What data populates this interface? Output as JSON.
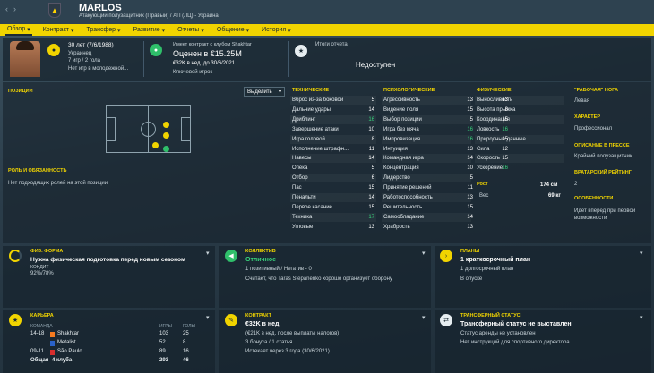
{
  "header": {
    "name": "MARLOS",
    "subtitle": "Атакующий полузащитник (Правый) / АП (ЛЦ) - Украина"
  },
  "tabs": [
    {
      "label": "Обзор",
      "arrow": "v"
    },
    {
      "label": "Контракт",
      "arrow": "v"
    },
    {
      "label": "Трансфер",
      "arrow": "v"
    },
    {
      "label": "Развитие",
      "arrow": "v"
    },
    {
      "label": "Отчеты",
      "arrow": "v"
    },
    {
      "label": "Общение",
      "arrow": "v"
    },
    {
      "label": "История",
      "arrow": "v"
    }
  ],
  "bio": {
    "age": "30 лет (7/6/1988)",
    "nationality": "Украинец",
    "caps": "7 игр / 2 гола",
    "youth": "Нет игр в молодежной..."
  },
  "contract": {
    "line1": "Имеет контракт с клубом Shakhtar",
    "value": "Оценен в €15.25M",
    "wage": "€32K в нед. до 30/6/2021",
    "status": "Ключевой игрок"
  },
  "report": {
    "title": "Итоги отчета",
    "value": "Недоступен"
  },
  "positions": {
    "title": "ПОЗИЦИИ",
    "select": "Выделить",
    "roles_title": "РОЛЬ И ОБЯЗАННОСТЬ",
    "roles_text": "Нет подходящих ролей на этой позиции"
  },
  "technical": {
    "title": "ТЕХНИЧЕСКИЕ",
    "items": [
      {
        "name": "Вброс из-за боковой",
        "value": "5",
        "color": "white"
      },
      {
        "name": "Дальние удары",
        "value": "14",
        "color": "white"
      },
      {
        "name": "Дриблинг",
        "value": "16",
        "color": "green"
      },
      {
        "name": "Завершение атаки",
        "value": "10",
        "color": "white"
      },
      {
        "name": "Игра головой",
        "value": "8",
        "color": "white"
      },
      {
        "name": "Исполнение штрафн...",
        "value": "11",
        "color": "white"
      },
      {
        "name": "Навесы",
        "value": "14",
        "color": "white"
      },
      {
        "name": "Опека",
        "value": "5",
        "color": "white"
      },
      {
        "name": "Отбор",
        "value": "6",
        "color": "white"
      },
      {
        "name": "Пас",
        "value": "15",
        "color": "white"
      },
      {
        "name": "Пенальти",
        "value": "14",
        "color": "white"
      },
      {
        "name": "Первое касание",
        "value": "15",
        "color": "white"
      },
      {
        "name": "Техника",
        "value": "17",
        "color": "green"
      },
      {
        "name": "Угловые",
        "value": "13",
        "color": "white"
      }
    ]
  },
  "mental": {
    "title": "ПСИХОЛОГИЧЕСКИЕ",
    "items": [
      {
        "name": "Агрессивность",
        "value": "13",
        "color": "white"
      },
      {
        "name": "Видение поля",
        "value": "15",
        "color": "white"
      },
      {
        "name": "Выбор позиции",
        "value": "5",
        "color": "white"
      },
      {
        "name": "Игра без мяча",
        "value": "16",
        "color": "green"
      },
      {
        "name": "Импровизация",
        "value": "16",
        "color": "green"
      },
      {
        "name": "Интуиция",
        "value": "13",
        "color": "white"
      },
      {
        "name": "Командная игра",
        "value": "14",
        "color": "white"
      },
      {
        "name": "Концентрация",
        "value": "10",
        "color": "white"
      },
      {
        "name": "Лидерство",
        "value": "5",
        "color": "white"
      },
      {
        "name": "Принятие решений",
        "value": "11",
        "color": "white"
      },
      {
        "name": "Работоспособность",
        "value": "13",
        "color": "white"
      },
      {
        "name": "Решительность",
        "value": "15",
        "color": "white"
      },
      {
        "name": "Самообладание",
        "value": "14",
        "color": "white"
      },
      {
        "name": "Храбрость",
        "value": "13",
        "color": "white"
      }
    ]
  },
  "physical": {
    "title": "ФИЗИЧЕСКИЕ",
    "items": [
      {
        "name": "Выносливость",
        "value": "13",
        "color": "white"
      },
      {
        "name": "Высота прыжка",
        "value": "8",
        "color": "white"
      },
      {
        "name": "Координация",
        "value": "15",
        "color": "white"
      },
      {
        "name": "Ловкость",
        "value": "16",
        "color": "green"
      },
      {
        "name": "Природные данные",
        "value": "15",
        "color": "white"
      },
      {
        "name": "Сила",
        "value": "12",
        "color": "white"
      },
      {
        "name": "Скорость",
        "value": "15",
        "color": "white"
      },
      {
        "name": "Ускорение",
        "value": "16",
        "color": "green"
      }
    ],
    "height_label": "Рост",
    "height": "174 см",
    "weight_label": "Вес",
    "weight": "69 кг"
  },
  "info": {
    "foot_title": "\"РАБОЧАЯ\" НОГА",
    "foot": "Левая",
    "char_title": "ХАРАКТЕР",
    "char": "Профессионал",
    "press_title": "ОПИСАНИЕ В ПРЕССЕ",
    "press": "Крайний полузащитник",
    "gk_title": "ВРАТАРСКИЙ РЕЙТИНГ",
    "gk": "2",
    "feat_title": "ОСОБЕННОСТИ",
    "feat": "Идет вперед при первой возможности"
  },
  "fitness": {
    "title": "ФИЗ. ФОРМА",
    "text": "Нужна физическая подготовка перед новым сезоном",
    "cond_label": "КОНДИТ",
    "cond": "92%/78%"
  },
  "morale": {
    "title": "КОЛЛЕКТИВ",
    "value": "Отличное",
    "line": "1 позитивный / Негатив - 0",
    "desc": "Считает, что Taras Stepanenko хорошо организует оборону"
  },
  "plans": {
    "title": "ПЛАНЫ",
    "value": "1 краткосрочный план",
    "line1": "1 долгосрочный план",
    "line2": "В опуске"
  },
  "career": {
    "title": "КАРЬЕРА",
    "headers": [
      "КОМАНДА",
      "ИГРЫ",
      "ГОЛЫ"
    ],
    "rows": [
      {
        "season": "14-18",
        "club": "Shakhtar",
        "games": "103",
        "goals": "25",
        "color": "#f47a20"
      },
      {
        "season": "",
        "club": "Metalist",
        "games": "52",
        "goals": "8",
        "color": "#2a62c9"
      },
      {
        "season": "09-11",
        "club": "São Paulo",
        "games": "89",
        "goals": "16",
        "color": "#d62d2d"
      },
      {
        "season": "Общая",
        "club": "4 клуба",
        "games": "293",
        "goals": "46",
        "color": ""
      }
    ]
  },
  "contract_panel": {
    "title": "КОНТРАКТ",
    "value": "€32K в нед.",
    "l1": "(€21K в нед. после выплаты налогов)",
    "l2": "3 бонуса / 1 статья",
    "l3": "Истекает через 3 года (30/6/2021)"
  },
  "transfer": {
    "title": "ТРАНСФЕРНЫЙ СТАТУС",
    "value": "Трансферный статус не выставлен",
    "l1": "Статус аренды не установлен",
    "l2": "Нет инструкций для спортивного директора"
  },
  "icons": {
    "accent": "#f1d400",
    "green": "#2fbf6a"
  }
}
